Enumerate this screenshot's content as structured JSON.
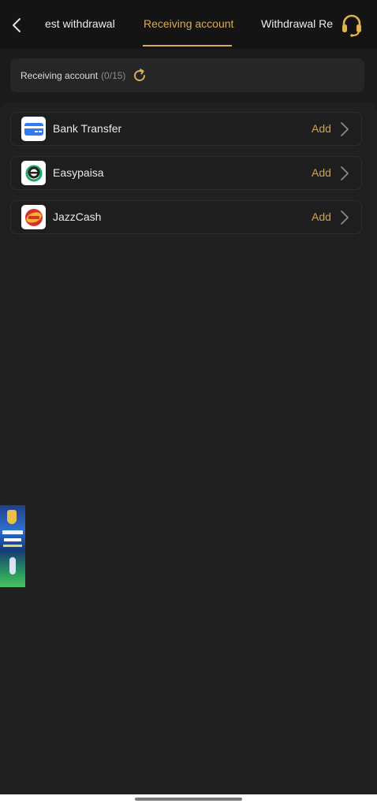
{
  "header": {
    "tabs": [
      {
        "label": "est withdrawal",
        "active": false
      },
      {
        "label": "Receiving account",
        "active": true
      },
      {
        "label": "Withdrawal Re",
        "active": false
      }
    ],
    "back_icon": "chevron-left-icon",
    "support_icon": "headset-icon"
  },
  "receiving_account": {
    "label": "Receiving account",
    "count": "(0/15)",
    "refresh_icon": "refresh-icon"
  },
  "methods": [
    {
      "name": "Bank Transfer",
      "action": "Add",
      "icon": "bank-card-icon"
    },
    {
      "name": "Easypaisa",
      "action": "Add",
      "icon": "easypaisa-logo"
    },
    {
      "name": "JazzCash",
      "action": "Add",
      "icon": "jazzcash-logo"
    }
  ],
  "colors": {
    "accent": "#d7ac56",
    "background": "#1b1b1b",
    "card": "#262626"
  }
}
